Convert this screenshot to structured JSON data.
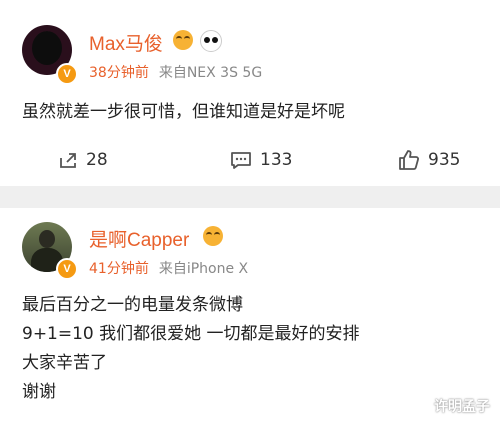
{
  "posts": [
    {
      "username": "Max马俊",
      "time": "38分钟前",
      "source": "来自NEX 3S 5G",
      "content": [
        "虽然就差一步很可惜，但谁知道是好是坏呢"
      ],
      "shares": "28",
      "comments": "133",
      "likes": "935"
    },
    {
      "username": "是啊Capper",
      "time": "41分钟前",
      "source": "来自iPhone X",
      "content": [
        "最后百分之一的电量发条微博",
        "9+1=10 我们都很爱她 一切都是最好的安排",
        "大家辛苦了",
        "谢谢"
      ]
    }
  ],
  "badge_text": "V",
  "watermark": "许明孟子",
  "colors": {
    "username": "#e8612c",
    "badge": "#f59a12",
    "separator": "#efefef"
  },
  "icons": {
    "share": "share-icon",
    "comment": "comment-icon",
    "like": "like-icon"
  }
}
